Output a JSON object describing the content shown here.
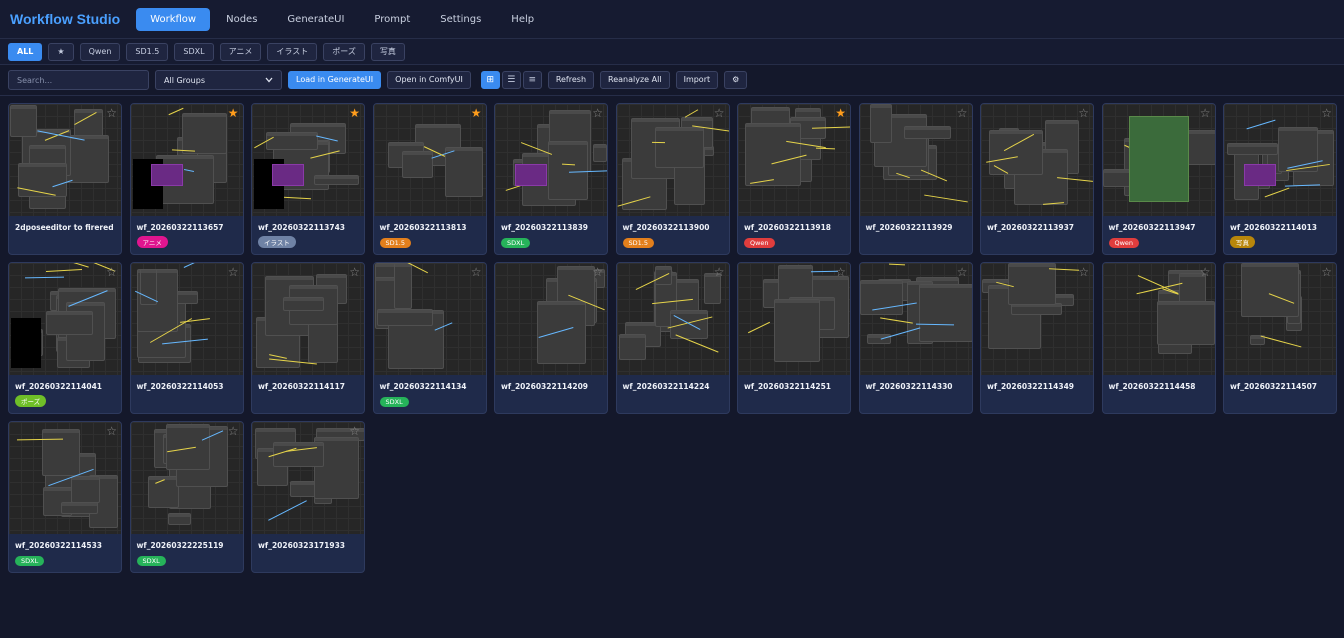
{
  "app": {
    "title": "Workflow Studio"
  },
  "nav": [
    "Workflow",
    "Nodes",
    "GenerateUI",
    "Prompt",
    "Settings",
    "Help"
  ],
  "tags": [
    "ALL",
    "★",
    "Qwen",
    "SD1.5",
    "SDXL",
    "アニメ",
    "イラスト",
    "ポーズ",
    "写真"
  ],
  "toolbar": {
    "search_placeholder": "Search...",
    "group_select": "All Groups",
    "load_generateui": "Load in GenerateUI",
    "open_comfyui": "Open in ComfyUI",
    "view_grid": "⊞",
    "view_list": "☰",
    "view_compact": "≡",
    "refresh": "Refresh",
    "reanalyze": "Reanalyze All",
    "import": "Import",
    "settings_glyph": "⚙"
  },
  "colors": {
    "accent": "#3a8bf0",
    "star_on": "#ff9d1c",
    "background": "#14182b",
    "card": "#1f2a4a"
  },
  "workflows": [
    {
      "name": "2dposeeditor to firered",
      "starred": false,
      "tag": ""
    },
    {
      "name": "wf_20260322113657",
      "starred": true,
      "tag": "アニメ",
      "tag_class": "b-anime"
    },
    {
      "name": "wf_20260322113743",
      "starred": true,
      "tag": "イラスト",
      "tag_class": "b-illust"
    },
    {
      "name": "wf_20260322113813",
      "starred": true,
      "tag": "SD1.5",
      "tag_class": "b-sd15"
    },
    {
      "name": "wf_20260322113839",
      "starred": false,
      "tag": "SDXL",
      "tag_class": "b-sdxl"
    },
    {
      "name": "wf_20260322113900",
      "starred": false,
      "tag": "SD1.5",
      "tag_class": "b-sd15"
    },
    {
      "name": "wf_20260322113918",
      "starred": true,
      "tag": "Qwen",
      "tag_class": "b-qwen"
    },
    {
      "name": "wf_20260322113929",
      "starred": false,
      "tag": ""
    },
    {
      "name": "wf_20260322113937",
      "starred": false,
      "tag": ""
    },
    {
      "name": "wf_20260322113947",
      "starred": false,
      "tag": "Qwen",
      "tag_class": "b-qwen"
    },
    {
      "name": "wf_20260322114013",
      "starred": false,
      "tag": "写真",
      "tag_class": "b-photo"
    },
    {
      "name": "wf_20260322114041",
      "starred": false,
      "tag": "ポーズ",
      "tag_class": "b-pose"
    },
    {
      "name": "wf_20260322114053",
      "starred": false,
      "tag": ""
    },
    {
      "name": "wf_20260322114117",
      "starred": false,
      "tag": ""
    },
    {
      "name": "wf_20260322114134",
      "starred": false,
      "tag": "SDXL",
      "tag_class": "b-sdxl"
    },
    {
      "name": "wf_20260322114209",
      "starred": false,
      "tag": ""
    },
    {
      "name": "wf_20260322114224",
      "starred": false,
      "tag": ""
    },
    {
      "name": "wf_20260322114251",
      "starred": false,
      "tag": ""
    },
    {
      "name": "wf_20260322114330",
      "starred": false,
      "tag": ""
    },
    {
      "name": "wf_20260322114349",
      "starred": false,
      "tag": ""
    },
    {
      "name": "wf_20260322114458",
      "starred": false,
      "tag": ""
    },
    {
      "name": "wf_20260322114507",
      "starred": false,
      "tag": ""
    },
    {
      "name": "wf_20260322114533",
      "starred": false,
      "tag": "SDXL",
      "tag_class": "b-sdxl"
    },
    {
      "name": "wf_20260322225119",
      "starred": false,
      "tag": "SDXL",
      "tag_class": "b-sdxl"
    },
    {
      "name": "wf_20260323171933",
      "starred": false,
      "tag": ""
    }
  ]
}
